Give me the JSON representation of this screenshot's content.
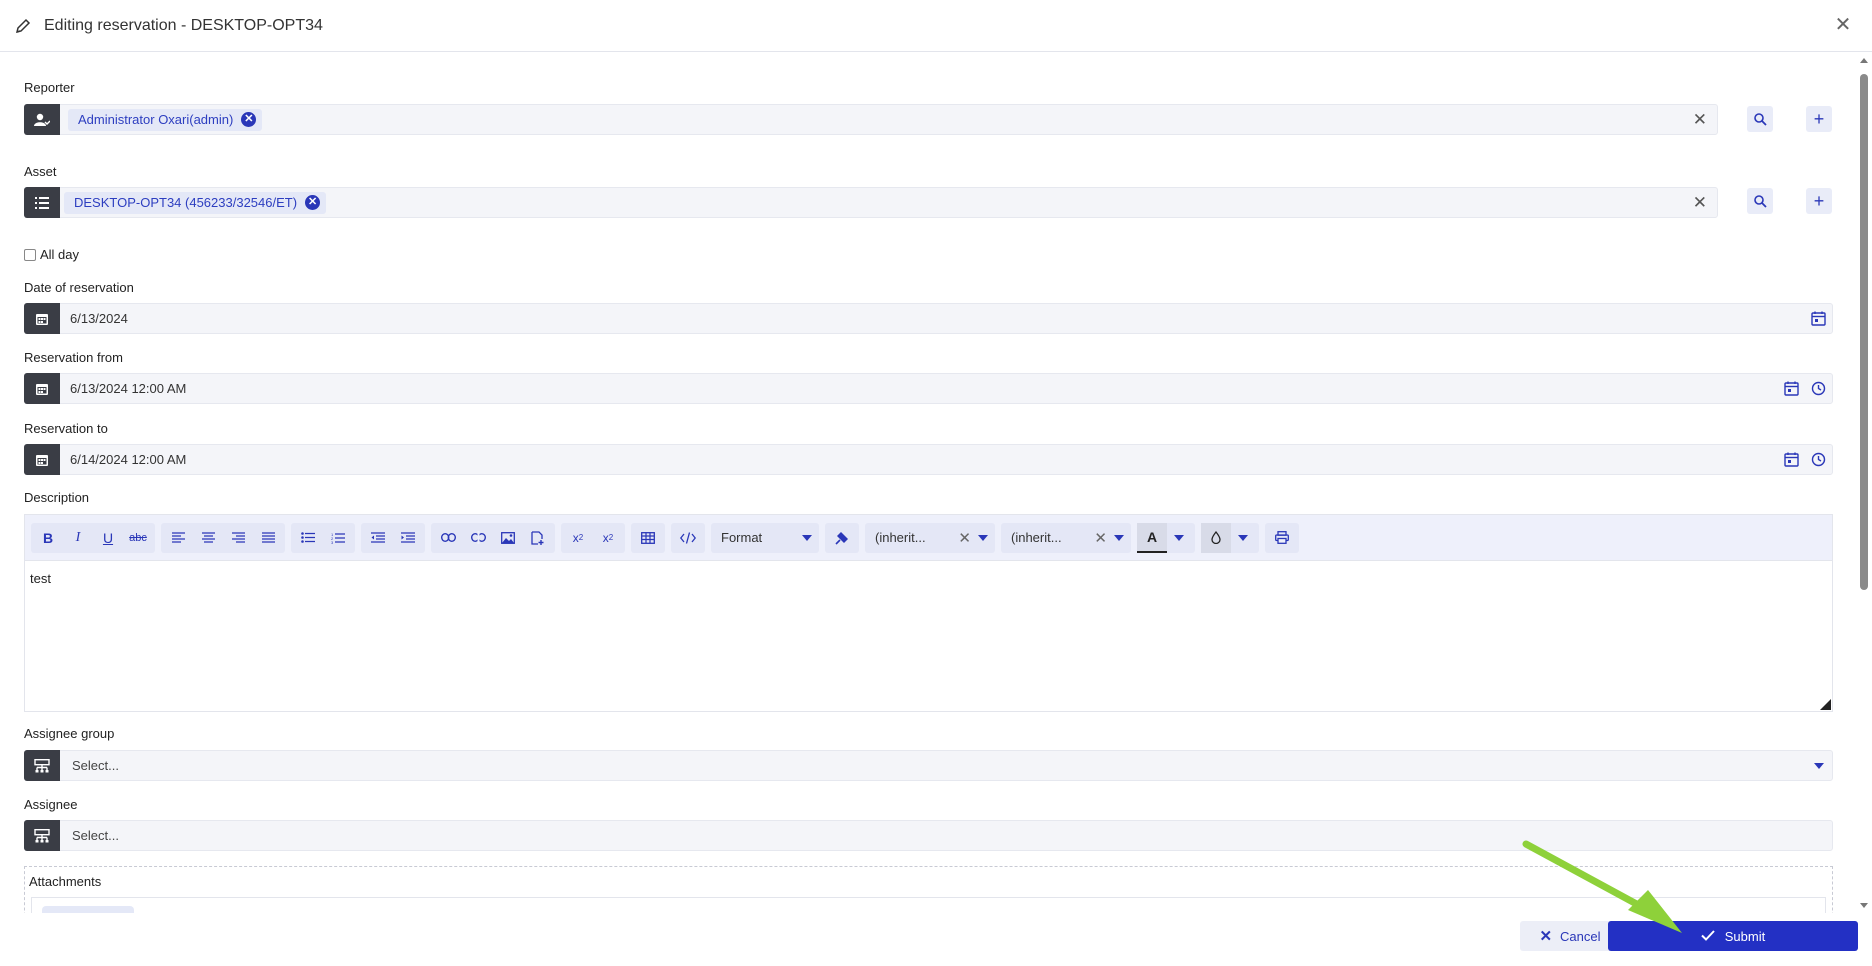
{
  "window": {
    "title": "Editing reservation - DESKTOP-OPT34"
  },
  "reporter": {
    "label": "Reporter",
    "chip": "Administrator Oxari(admin)"
  },
  "asset": {
    "label": "Asset",
    "chip": "DESKTOP-OPT34 (456233/32546/ET)"
  },
  "all_day": {
    "label": "All day",
    "checked": false
  },
  "date_of_reservation": {
    "label": "Date of reservation",
    "value": "6/13/2024"
  },
  "reservation_from": {
    "label": "Reservation from",
    "value": "6/13/2024 12:00 AM"
  },
  "reservation_to": {
    "label": "Reservation to",
    "value": "6/14/2024 12:00 AM"
  },
  "description": {
    "label": "Description",
    "content": "test",
    "toolbar": {
      "format": "Format",
      "font_family": "(inherit...",
      "font_size": "(inherit..."
    }
  },
  "assignee_group": {
    "label": "Assignee group",
    "placeholder": "Select..."
  },
  "assignee": {
    "label": "Assignee",
    "placeholder": "Select..."
  },
  "attachments": {
    "label": "Attachments"
  },
  "footer": {
    "cancel_label": "Cancel",
    "submit_label": "Submit"
  },
  "colors": {
    "accent": "#2330c4",
    "lead_icon_bg": "#3a3d45",
    "chip_bg": "#e4e8f7",
    "arrow": "#8ed13a"
  }
}
